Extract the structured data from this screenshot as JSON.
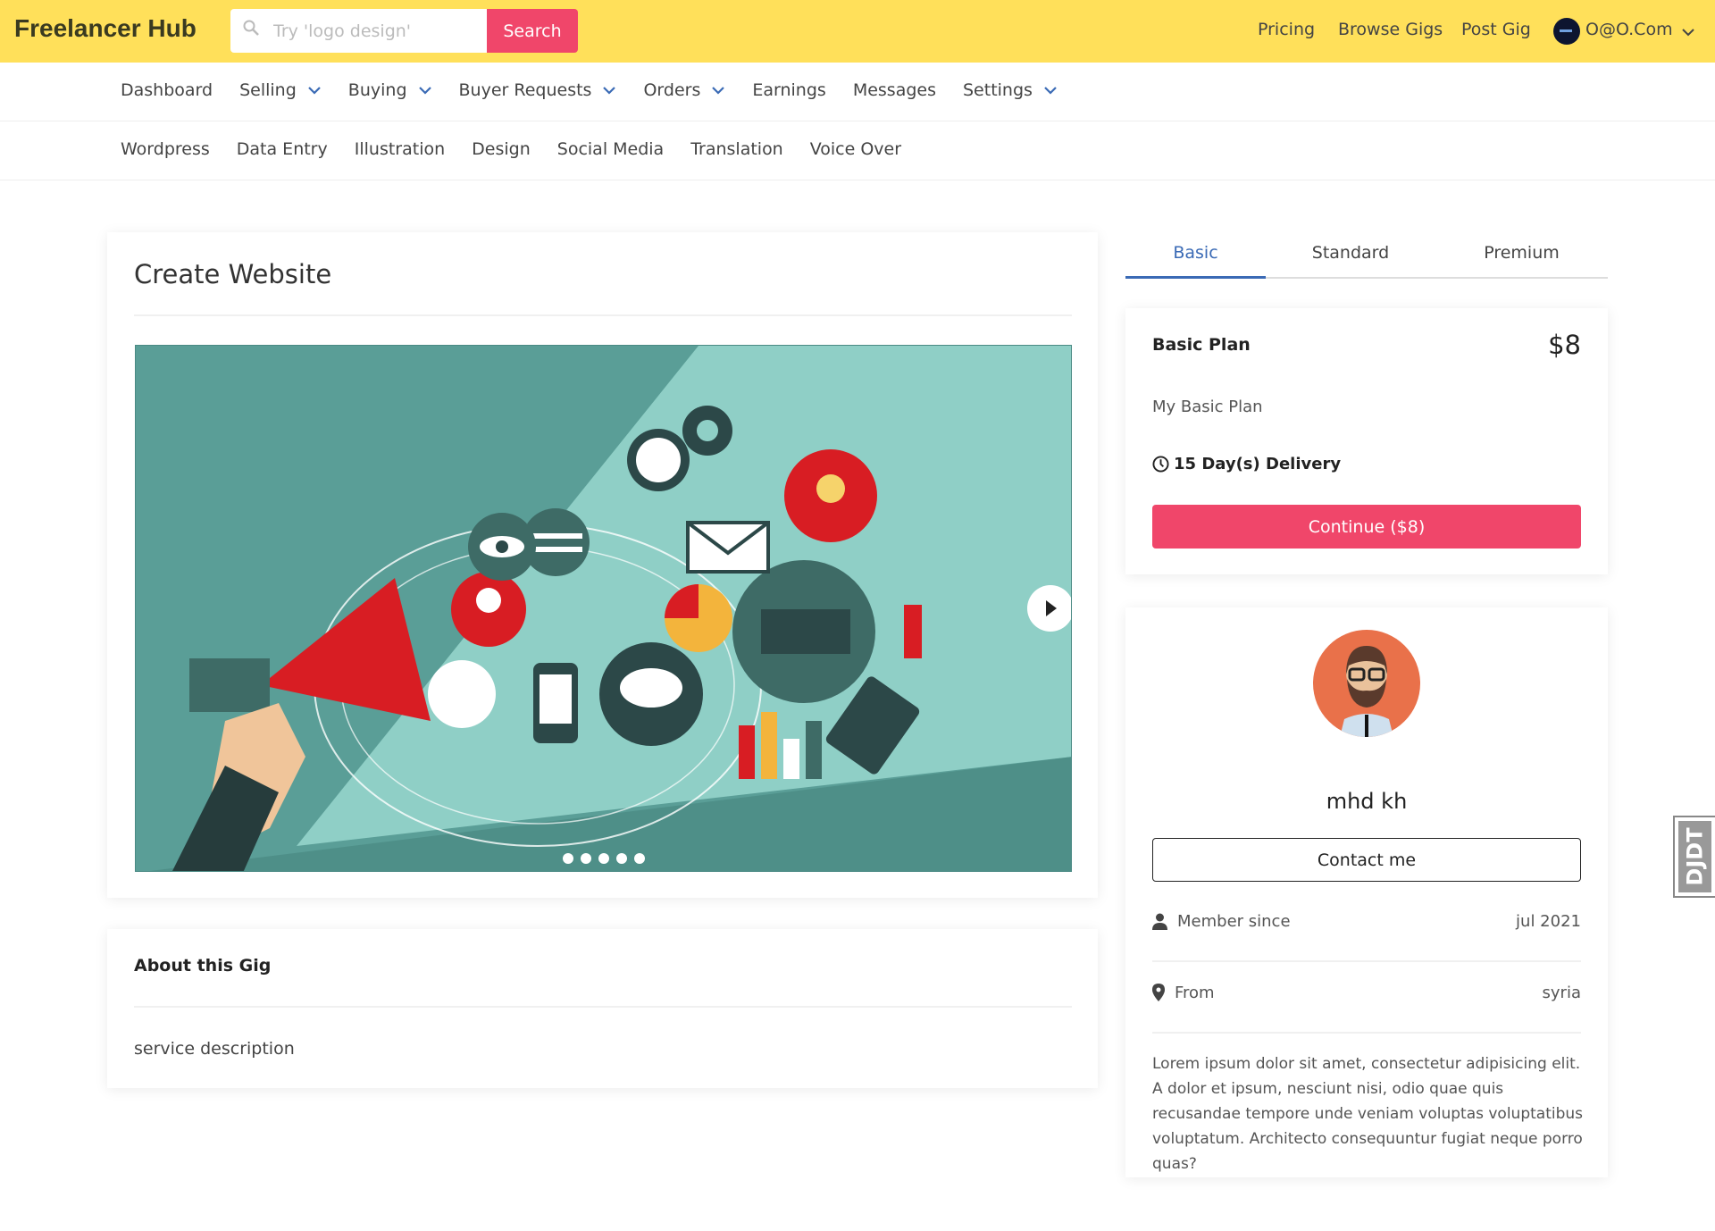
{
  "header": {
    "logo": "Freelancer Hub",
    "search_placeholder": "Try 'logo design'",
    "search_button": "Search",
    "links": [
      "Pricing",
      "Browse Gigs",
      "Post Gig"
    ],
    "user_email": "O@O.Com",
    "brand_color": "#ffe05a",
    "accent_color": "#f0466a"
  },
  "nav": {
    "items": [
      {
        "label": "Dashboard",
        "dropdown": false
      },
      {
        "label": "Selling",
        "dropdown": true
      },
      {
        "label": "Buying",
        "dropdown": true
      },
      {
        "label": "Buyer Requests",
        "dropdown": true
      },
      {
        "label": "Orders",
        "dropdown": true
      },
      {
        "label": "Earnings",
        "dropdown": false
      },
      {
        "label": "Messages",
        "dropdown": false
      },
      {
        "label": "Settings",
        "dropdown": true
      }
    ],
    "categories": [
      "Wordpress",
      "Data Entry",
      "Illustration",
      "Design",
      "Social Media",
      "Translation",
      "Voice Over"
    ]
  },
  "gig": {
    "title": "Create Website",
    "carousel": {
      "slides": 5,
      "active": 0
    },
    "about_title": "About this Gig",
    "description": "service description"
  },
  "plans": {
    "tabs": [
      "Basic",
      "Standard",
      "Premium"
    ],
    "active_tab": "Basic",
    "name": "Basic Plan",
    "price": "$8",
    "description": "My Basic Plan",
    "delivery": "15 Day(s) Delivery",
    "continue_button": "Continue ($8)"
  },
  "seller": {
    "name": "mhd kh",
    "contact_button": "Contact me",
    "member_since_label": "Member since",
    "member_since": "jul 2021",
    "from_label": "From",
    "from": "syria",
    "bio": "Lorem ipsum dolor sit amet, consectetur adipisicing elit. A dolor et ipsum, nesciunt nisi, odio quae quis recusandae tempore unde veniam voluptas voluptatibus voluptatum. Architecto consequuntur fugiat neque porro quas?"
  },
  "debug_toolbar": {
    "label": "DJDT"
  }
}
